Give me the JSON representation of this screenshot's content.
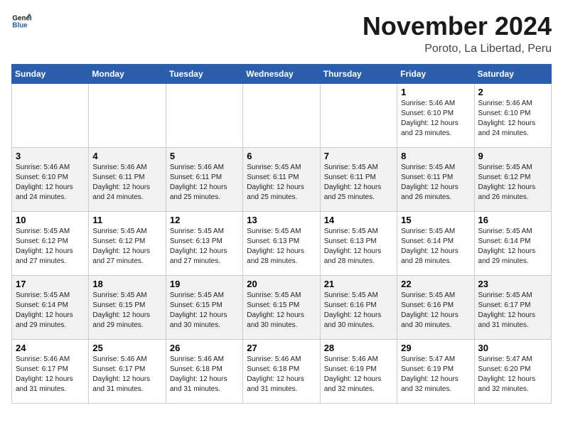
{
  "logo": {
    "line1": "General",
    "line2": "Blue"
  },
  "title": "November 2024",
  "location": "Poroto, La Libertad, Peru",
  "days_of_week": [
    "Sunday",
    "Monday",
    "Tuesday",
    "Wednesday",
    "Thursday",
    "Friday",
    "Saturday"
  ],
  "weeks": [
    [
      {
        "day": "",
        "info": ""
      },
      {
        "day": "",
        "info": ""
      },
      {
        "day": "",
        "info": ""
      },
      {
        "day": "",
        "info": ""
      },
      {
        "day": "",
        "info": ""
      },
      {
        "day": "1",
        "info": "Sunrise: 5:46 AM\nSunset: 6:10 PM\nDaylight: 12 hours\nand 23 minutes."
      },
      {
        "day": "2",
        "info": "Sunrise: 5:46 AM\nSunset: 6:10 PM\nDaylight: 12 hours\nand 24 minutes."
      }
    ],
    [
      {
        "day": "3",
        "info": "Sunrise: 5:46 AM\nSunset: 6:10 PM\nDaylight: 12 hours\nand 24 minutes."
      },
      {
        "day": "4",
        "info": "Sunrise: 5:46 AM\nSunset: 6:11 PM\nDaylight: 12 hours\nand 24 minutes."
      },
      {
        "day": "5",
        "info": "Sunrise: 5:46 AM\nSunset: 6:11 PM\nDaylight: 12 hours\nand 25 minutes."
      },
      {
        "day": "6",
        "info": "Sunrise: 5:45 AM\nSunset: 6:11 PM\nDaylight: 12 hours\nand 25 minutes."
      },
      {
        "day": "7",
        "info": "Sunrise: 5:45 AM\nSunset: 6:11 PM\nDaylight: 12 hours\nand 25 minutes."
      },
      {
        "day": "8",
        "info": "Sunrise: 5:45 AM\nSunset: 6:11 PM\nDaylight: 12 hours\nand 26 minutes."
      },
      {
        "day": "9",
        "info": "Sunrise: 5:45 AM\nSunset: 6:12 PM\nDaylight: 12 hours\nand 26 minutes."
      }
    ],
    [
      {
        "day": "10",
        "info": "Sunrise: 5:45 AM\nSunset: 6:12 PM\nDaylight: 12 hours\nand 27 minutes."
      },
      {
        "day": "11",
        "info": "Sunrise: 5:45 AM\nSunset: 6:12 PM\nDaylight: 12 hours\nand 27 minutes."
      },
      {
        "day": "12",
        "info": "Sunrise: 5:45 AM\nSunset: 6:13 PM\nDaylight: 12 hours\nand 27 minutes."
      },
      {
        "day": "13",
        "info": "Sunrise: 5:45 AM\nSunset: 6:13 PM\nDaylight: 12 hours\nand 28 minutes."
      },
      {
        "day": "14",
        "info": "Sunrise: 5:45 AM\nSunset: 6:13 PM\nDaylight: 12 hours\nand 28 minutes."
      },
      {
        "day": "15",
        "info": "Sunrise: 5:45 AM\nSunset: 6:14 PM\nDaylight: 12 hours\nand 28 minutes."
      },
      {
        "day": "16",
        "info": "Sunrise: 5:45 AM\nSunset: 6:14 PM\nDaylight: 12 hours\nand 29 minutes."
      }
    ],
    [
      {
        "day": "17",
        "info": "Sunrise: 5:45 AM\nSunset: 6:14 PM\nDaylight: 12 hours\nand 29 minutes."
      },
      {
        "day": "18",
        "info": "Sunrise: 5:45 AM\nSunset: 6:15 PM\nDaylight: 12 hours\nand 29 minutes."
      },
      {
        "day": "19",
        "info": "Sunrise: 5:45 AM\nSunset: 6:15 PM\nDaylight: 12 hours\nand 30 minutes."
      },
      {
        "day": "20",
        "info": "Sunrise: 5:45 AM\nSunset: 6:15 PM\nDaylight: 12 hours\nand 30 minutes."
      },
      {
        "day": "21",
        "info": "Sunrise: 5:45 AM\nSunset: 6:16 PM\nDaylight: 12 hours\nand 30 minutes."
      },
      {
        "day": "22",
        "info": "Sunrise: 5:45 AM\nSunset: 6:16 PM\nDaylight: 12 hours\nand 30 minutes."
      },
      {
        "day": "23",
        "info": "Sunrise: 5:45 AM\nSunset: 6:17 PM\nDaylight: 12 hours\nand 31 minutes."
      }
    ],
    [
      {
        "day": "24",
        "info": "Sunrise: 5:46 AM\nSunset: 6:17 PM\nDaylight: 12 hours\nand 31 minutes."
      },
      {
        "day": "25",
        "info": "Sunrise: 5:46 AM\nSunset: 6:17 PM\nDaylight: 12 hours\nand 31 minutes."
      },
      {
        "day": "26",
        "info": "Sunrise: 5:46 AM\nSunset: 6:18 PM\nDaylight: 12 hours\nand 31 minutes."
      },
      {
        "day": "27",
        "info": "Sunrise: 5:46 AM\nSunset: 6:18 PM\nDaylight: 12 hours\nand 31 minutes."
      },
      {
        "day": "28",
        "info": "Sunrise: 5:46 AM\nSunset: 6:19 PM\nDaylight: 12 hours\nand 32 minutes."
      },
      {
        "day": "29",
        "info": "Sunrise: 5:47 AM\nSunset: 6:19 PM\nDaylight: 12 hours\nand 32 minutes."
      },
      {
        "day": "30",
        "info": "Sunrise: 5:47 AM\nSunset: 6:20 PM\nDaylight: 12 hours\nand 32 minutes."
      }
    ]
  ]
}
